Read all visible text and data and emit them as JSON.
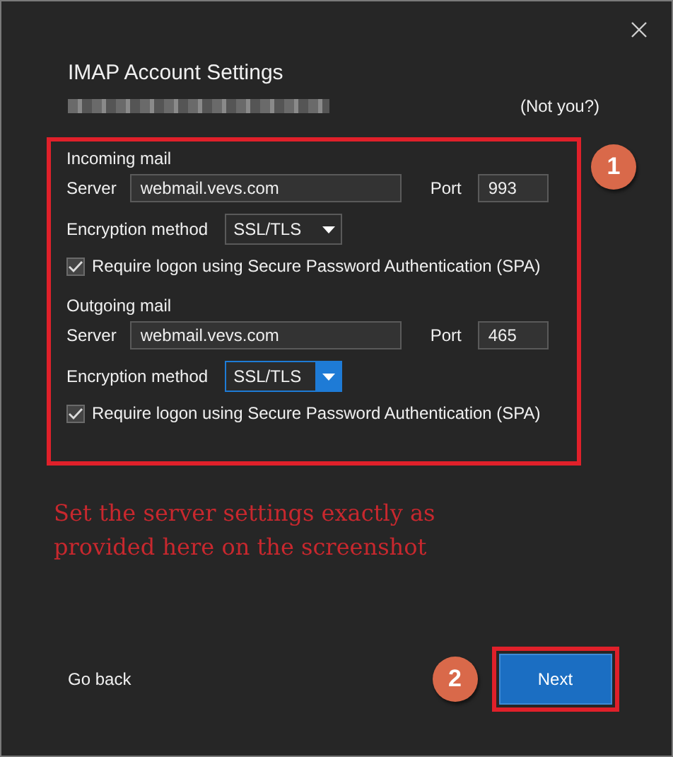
{
  "window": {
    "title": "IMAP Account Settings",
    "not_you_link": "(Not you?)"
  },
  "sections": [
    {
      "heading": "Incoming mail",
      "server_label": "Server",
      "server": "webmail.vevs.com",
      "port_label": "Port",
      "port": "993",
      "encryption_label": "Encryption method",
      "encryption": "SSL/TLS",
      "encryption_focused": false,
      "spa_label": "Require logon using Secure Password Authentication (SPA)",
      "spa_checked": true
    },
    {
      "heading": "Outgoing mail",
      "server_label": "Server",
      "server": "webmail.vevs.com",
      "port_label": "Port",
      "port": "465",
      "encryption_label": "Encryption method",
      "encryption": "SSL/TLS",
      "encryption_focused": true,
      "spa_label": "Require logon using Secure Password Authentication (SPA)",
      "spa_checked": true
    }
  ],
  "annotation": {
    "text": "Set the server settings exactly as provided here on the screenshot",
    "badges": [
      "1",
      "2"
    ]
  },
  "buttons": {
    "back": "Go back",
    "next": "Next"
  }
}
